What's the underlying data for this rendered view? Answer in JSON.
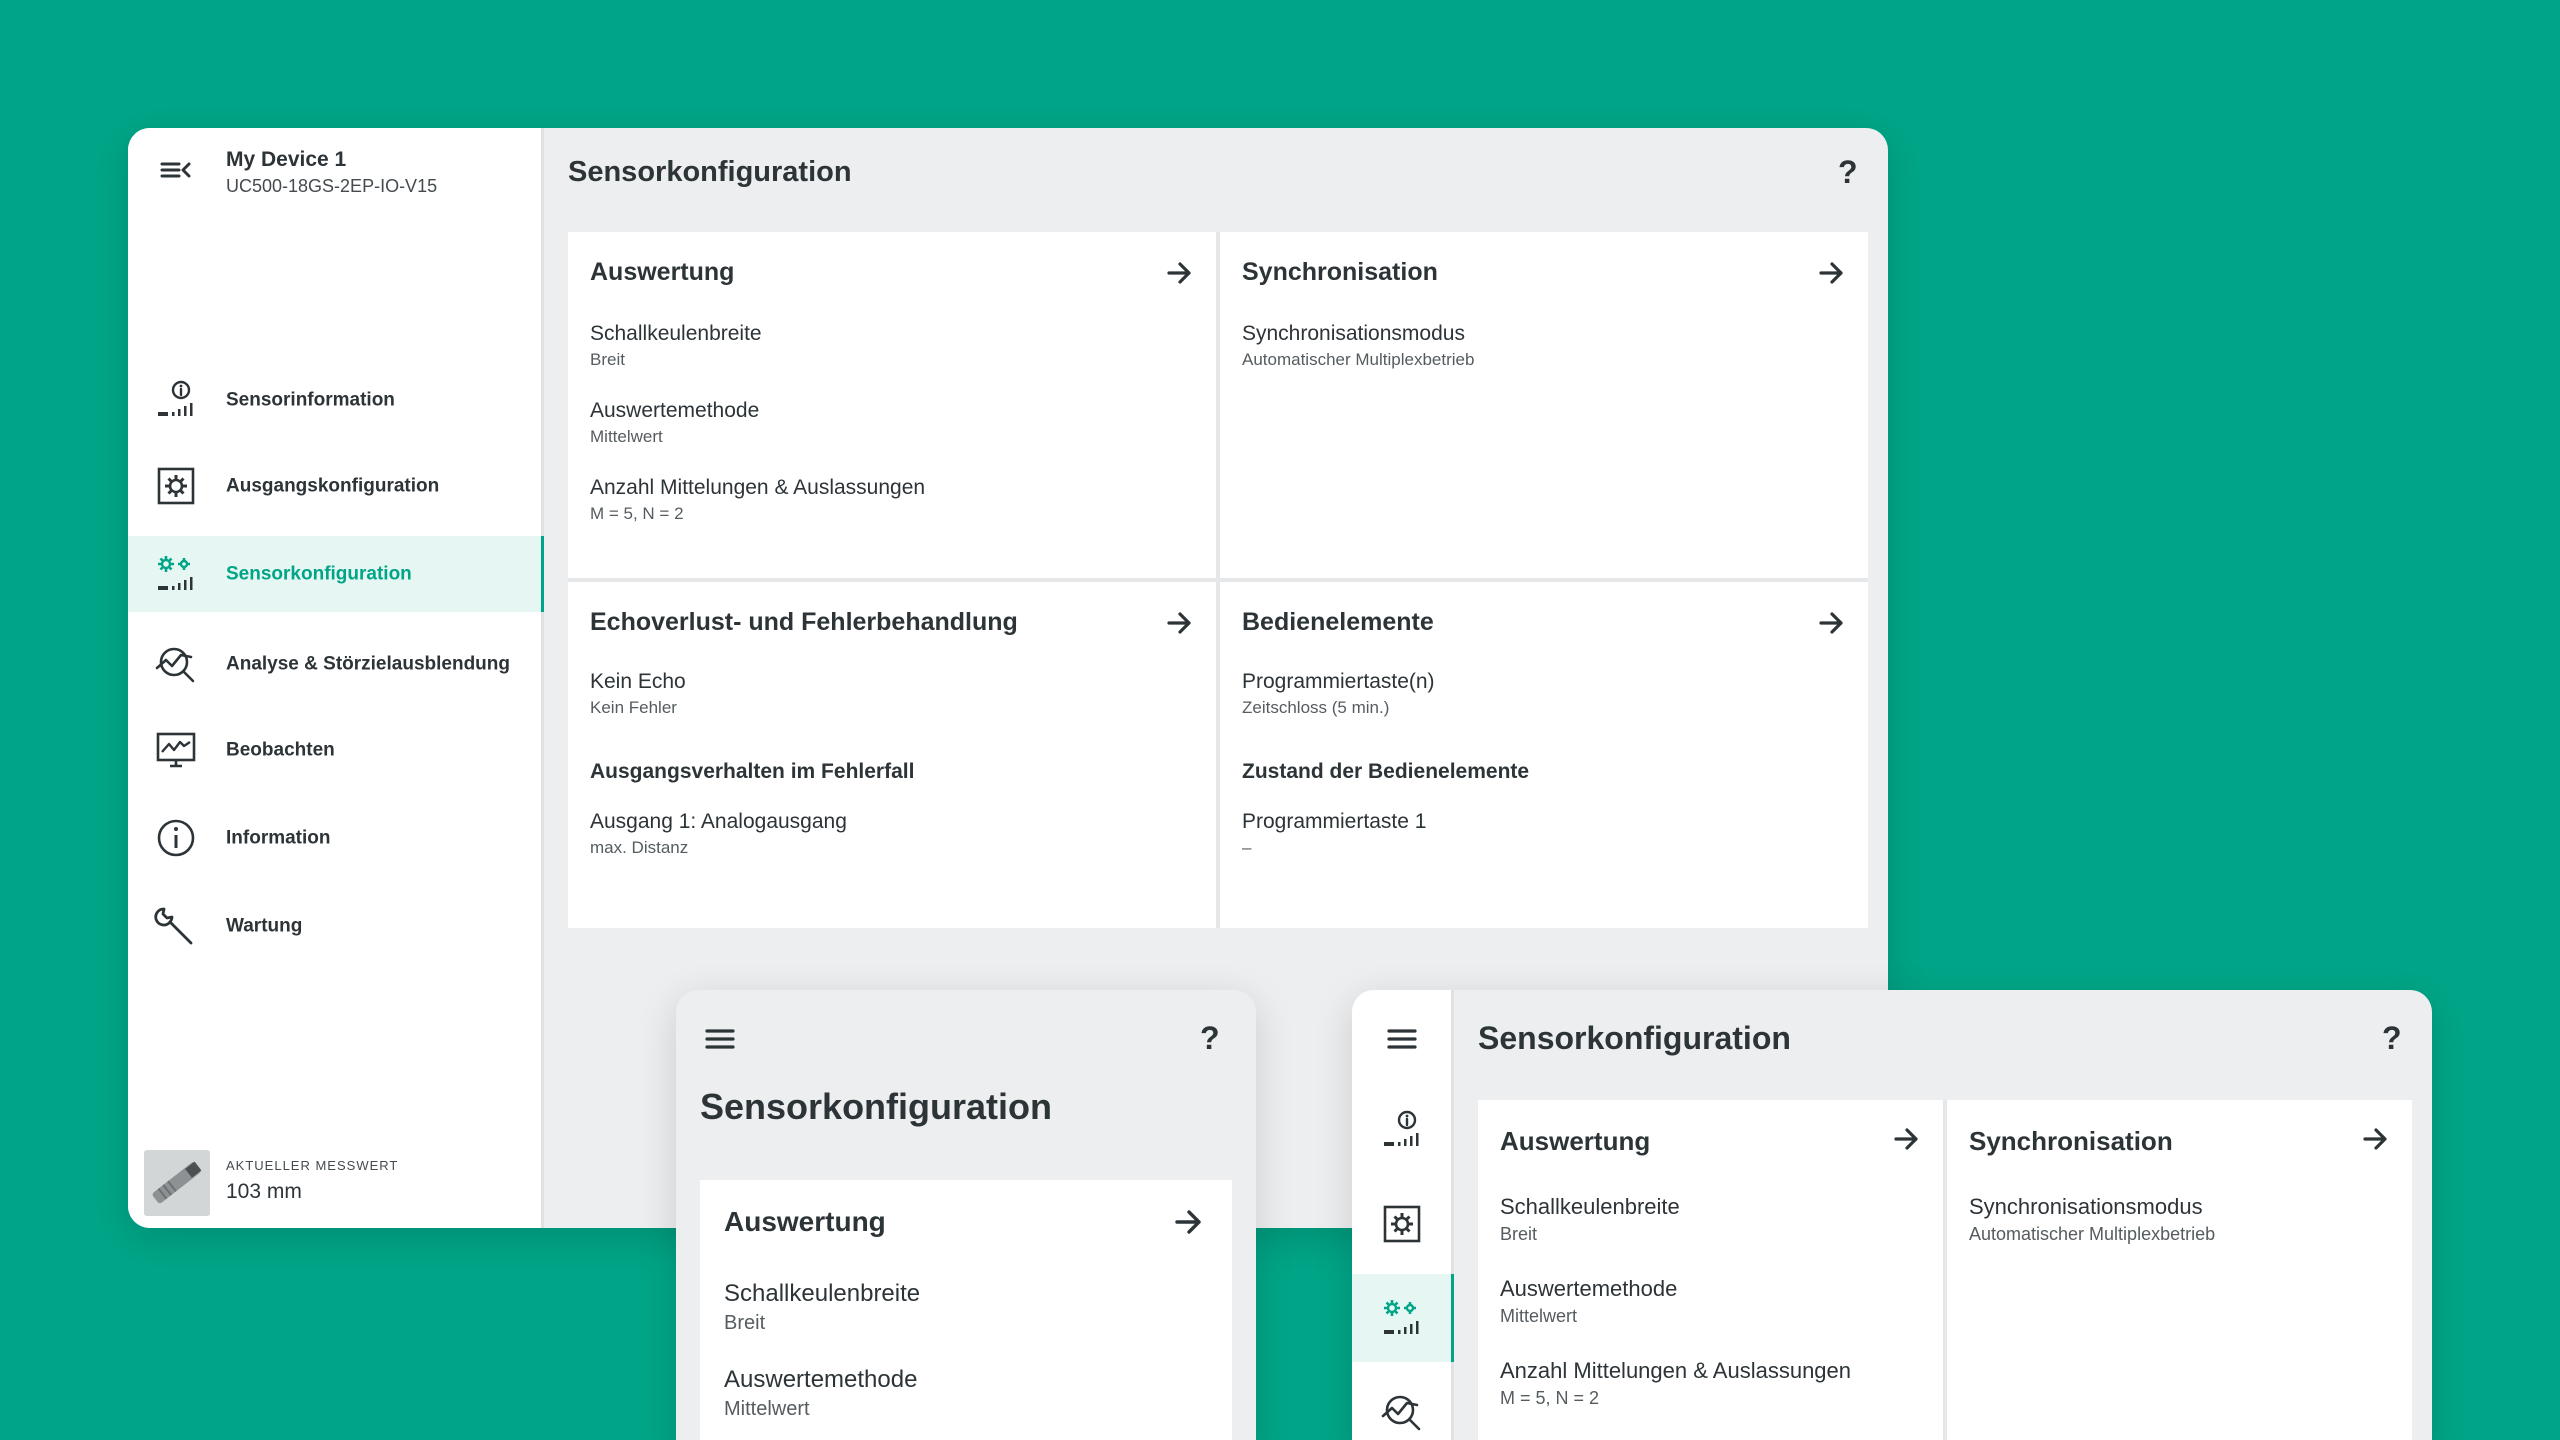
{
  "colors": {
    "background": "#00a587",
    "accent": "#00a587",
    "text": "#2d3438",
    "panel": "#edeeef"
  },
  "device": {
    "name": "My Device 1",
    "model": "UC500-18GS-2EP-IO-V15"
  },
  "nav": [
    {
      "label": "Sensorinformation",
      "icon": "sensor-info-icon"
    },
    {
      "label": "Ausgangskonfiguration",
      "icon": "output-config-icon"
    },
    {
      "label": "Sensorkonfiguration",
      "icon": "sensor-config-icon",
      "active": true
    },
    {
      "label": "Analyse & Störzielausblendung",
      "icon": "analysis-icon"
    },
    {
      "label": "Beobachten",
      "icon": "monitor-icon"
    },
    {
      "label": "Information",
      "icon": "info-icon"
    },
    {
      "label": "Wartung",
      "icon": "wrench-icon"
    }
  ],
  "measurement": {
    "caption": "AKTUELLER MESSWERT",
    "value": "103 mm"
  },
  "page": {
    "title": "Sensorkonfiguration",
    "help": "?"
  },
  "cards": {
    "auswertung": {
      "title": "Auswertung",
      "fields": [
        {
          "label": "Schallkeulenbreite",
          "value": "Breit"
        },
        {
          "label": "Auswertemethode",
          "value": "Mittelwert"
        },
        {
          "label": "Anzahl Mittelungen & Auslassungen",
          "value": "M = 5, N = 2"
        }
      ]
    },
    "synchronisation": {
      "title": "Synchronisation",
      "fields": [
        {
          "label": "Synchronisationsmodus",
          "value": "Automatischer Multiplexbetrieb"
        }
      ]
    },
    "echoverlust": {
      "title": "Echoverlust- und Fehlerbehandlung",
      "fields": [
        {
          "label": "Kein Echo",
          "value": "Kein Fehler"
        }
      ],
      "subheading": "Ausgangsverhalten im Fehlerfall",
      "subfields": [
        {
          "label": "Ausgang 1: Analogausgang",
          "value": "max. Distanz"
        }
      ]
    },
    "bedienelemente": {
      "title": "Bedienelemente",
      "fields": [
        {
          "label": "Programmiertaste(n)",
          "value": "Zeitschloss (5 min.)"
        }
      ],
      "subheading": "Zustand der Bedienelemente",
      "subfields": [
        {
          "label": "Programmiertaste 1",
          "value": "–"
        }
      ]
    }
  }
}
